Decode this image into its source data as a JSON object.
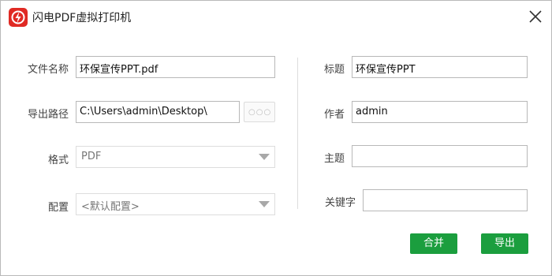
{
  "window": {
    "title": "闪电PDF虚拟打印机"
  },
  "left": {
    "filename_label": "文件名称",
    "filename_value": "环保宣传PPT.pdf",
    "export_path_label": "导出路径",
    "export_path_value": "C:\\Users\\admin\\Desktop\\",
    "browse_dots": "○○○",
    "format_label": "格式",
    "format_value": "PDF",
    "config_label": "配置",
    "config_value": "<默认配置>"
  },
  "right": {
    "title_label": "标题",
    "title_value": "环保宣传PPT",
    "author_label": "作者",
    "author_value": "admin",
    "subject_label": "主题",
    "subject_value": "",
    "keywords_label": "关键字",
    "keywords_value": ""
  },
  "buttons": {
    "merge_label": "合并",
    "export_label": "导出"
  },
  "colors": {
    "accent_green": "#1b9e3e",
    "app_icon_red": "#e02a24"
  },
  "icons": {
    "app": "lightning-pdf-icon",
    "close": "close-icon",
    "dropdown": "chevron-down-icon"
  }
}
